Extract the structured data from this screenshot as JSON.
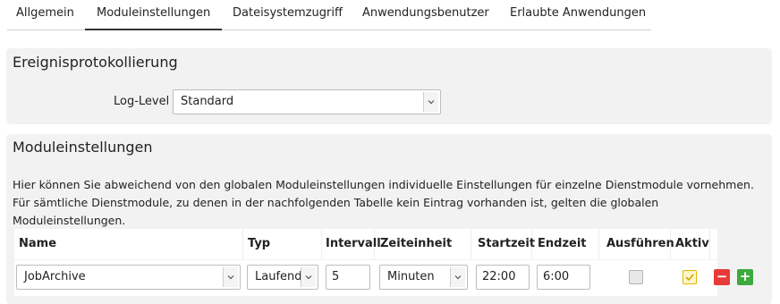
{
  "tabs": [
    {
      "label": "Allgemein"
    },
    {
      "label": "Moduleinstellungen",
      "active": true
    },
    {
      "label": "Dateisystemzugriff"
    },
    {
      "label": "Anwendungsbenutzer"
    },
    {
      "label": "Erlaubte Anwendungen"
    }
  ],
  "event_logging": {
    "title": "Ereignisprotokollierung",
    "log_level_label": "Log-Level",
    "log_level_value": "Standard"
  },
  "module_settings": {
    "title": "Moduleinstellungen",
    "description": "Hier können Sie abweichend von den globalen Moduleinstellungen individuelle Einstellungen für einzelne Dienstmodule vornehmen. Für sämtliche Dienstmodule, zu denen in der nachfolgenden Tabelle kein Eintrag vorhanden ist, gelten die globalen Moduleinstellungen.",
    "columns": [
      "Name",
      "Typ",
      "Intervall",
      "Zeiteinheit",
      "Startzeit",
      "Endzeit",
      "Ausführen",
      "Aktiv"
    ],
    "rows": [
      {
        "name": "JobArchive",
        "typ": "Laufend",
        "intervall": "5",
        "zeiteinheit": "Minuten",
        "startzeit": "22:00",
        "endzeit": "6:00",
        "ausfuehren": false,
        "aktiv": true
      }
    ],
    "remove_symbol": "−",
    "add_symbol": "+"
  },
  "colors": {
    "remove": "#e83a3a",
    "add": "#3daa3d",
    "active_check": "#e6b400"
  }
}
